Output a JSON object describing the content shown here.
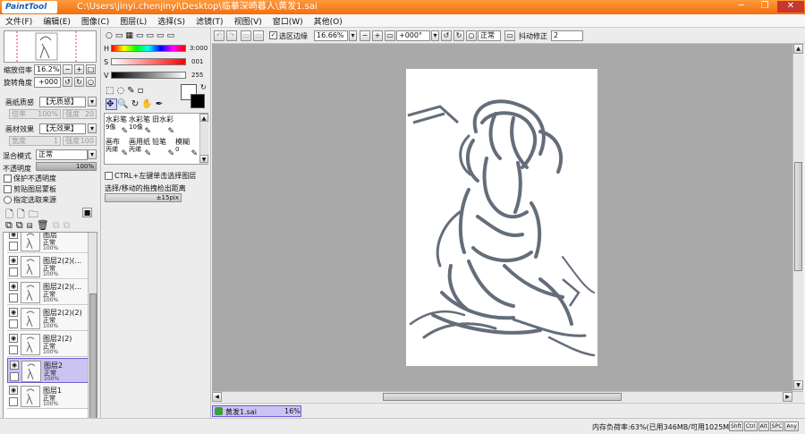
{
  "titlebar": {
    "logo": "PaintTool SAI",
    "title": "C:\\Users\\jinyi.chenjinyi\\Desktop\\临摹深崎暮人\\黄发1.sai",
    "minimize": "─",
    "restore": "❐",
    "close": "✕"
  },
  "menu": [
    "文件(F)",
    "编辑(E)",
    "图像(C)",
    "图层(L)",
    "选择(S)",
    "滤镜(T)",
    "视图(V)",
    "窗口(W)",
    "其他(O)"
  ],
  "navigator": {
    "zoom_label": "缩放倍率",
    "zoom_value": "16.2%",
    "rotate_label": "旋转角度",
    "rotate_value": "+000"
  },
  "layer_props": {
    "paper_label": "画纸质感",
    "paper_value": "【无质感】",
    "paper_scale": "100%",
    "paper_strength_label": "强度",
    "paper_strength": "20",
    "paper_scale_label": "倍率",
    "material_label": "画材效果",
    "material_value": "【无效果】",
    "material_width_label": "宽度",
    "material_width": "1",
    "material_strength_label": "强度",
    "material_strength": "100",
    "blend_label": "混合模式",
    "blend_value": "正常",
    "opacity_label": "不透明度",
    "opacity_value": "100%",
    "opacity_fraction": 1.0,
    "check_preserve": "保护不透明度",
    "check_clip": "剪贴图层蒙板",
    "check_source": "指定选取来源"
  },
  "color": {
    "h_label": "H",
    "h_value": "3:000",
    "s_label": "S",
    "s_value": "001",
    "v_label": "V",
    "v_value": "255",
    "foreground": "#ffffff",
    "background": "#000000"
  },
  "tools": {
    "brushes": [
      {
        "name": "水彩笔",
        "size": "9像"
      },
      {
        "name": "水彩笔",
        "size": "10像"
      },
      {
        "name": "旧水彩",
        "size": ""
      },
      {
        "name": "画布",
        "size": "丙烯"
      },
      {
        "name": "画用纸",
        "size": "丙烯"
      },
      {
        "name": "铅笔",
        "size": ""
      },
      {
        "name": "模糊",
        "size": "0"
      }
    ],
    "ctrl_check": "CTRL+左键单击选择图层",
    "drag_label": "选择/移动的拖拽检出距离",
    "drag_value": "±15pix"
  },
  "toolbar": {
    "selection_edge_label": "选区边缘",
    "zoom": "16.66%",
    "angle": "+000°",
    "mode": "正常",
    "stabilizer_label": "抖动修正",
    "stabilizer_value": "2"
  },
  "layers": [
    {
      "name": "图层",
      "mode": "正常",
      "opacity": "100%",
      "selected": false
    },
    {
      "name": "图层2(2)(...",
      "mode": "正常",
      "opacity": "100%",
      "selected": false
    },
    {
      "name": "图层2(2)(...",
      "mode": "正常",
      "opacity": "100%",
      "selected": false
    },
    {
      "name": "图层2(2)(2)",
      "mode": "正常",
      "opacity": "100%",
      "selected": false
    },
    {
      "name": "图层2(2)",
      "mode": "正常",
      "opacity": "100%",
      "selected": false
    },
    {
      "name": "图层2",
      "mode": "正常",
      "opacity": "100%",
      "selected": true
    },
    {
      "name": "图层1",
      "mode": "正常",
      "opacity": "100%",
      "selected": false
    }
  ],
  "document_tab": {
    "name": "黄发1.sai",
    "zoom": "16%"
  },
  "status": {
    "memory": "内存负荷率:63%(已用346MB/可用1025MB)",
    "keys": [
      "Shft",
      "Ctrl",
      "Alt",
      "SPC",
      "Any"
    ]
  },
  "colors": {
    "accent_orange": "#f26e10",
    "selected_layer": "#cbc4f3",
    "canvas_bg": "#a9a9a9",
    "sketch_stroke": "#4a5563"
  }
}
